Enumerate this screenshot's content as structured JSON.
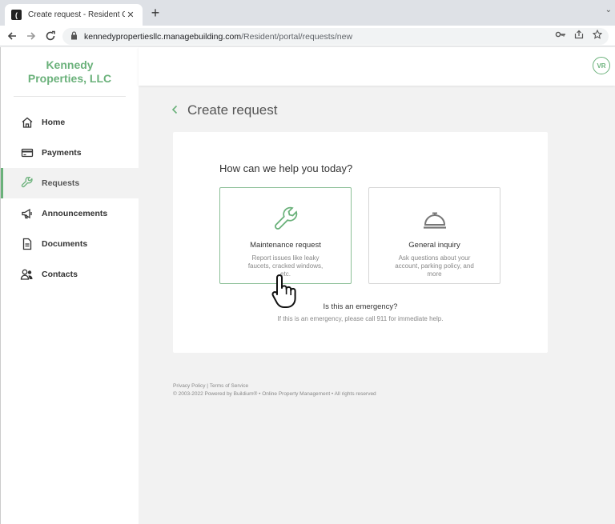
{
  "browser": {
    "tab_title": "Create request - Resident Center",
    "url_domain": "kennedypropertiesllc.managebuilding.com",
    "url_path": "/Resident/portal/requests/new"
  },
  "brand": {
    "line1": "Kennedy",
    "line2": "Properties, LLC",
    "color": "#6ab17a"
  },
  "sidebar": {
    "items": [
      {
        "label": "Home",
        "icon": "home-icon",
        "active": false
      },
      {
        "label": "Payments",
        "icon": "credit-card-icon",
        "active": false
      },
      {
        "label": "Requests",
        "icon": "wrench-icon",
        "active": true
      },
      {
        "label": "Announcements",
        "icon": "megaphone-icon",
        "active": false
      },
      {
        "label": "Documents",
        "icon": "document-icon",
        "active": false
      },
      {
        "label": "Contacts",
        "icon": "contacts-icon",
        "active": false
      }
    ]
  },
  "header": {
    "avatar_initials": "VR"
  },
  "page": {
    "title": "Create request",
    "question": "How can we help you today?",
    "options": [
      {
        "title": "Maintenance request",
        "description": "Report issues like leaky faucets, cracked windows, etc.",
        "icon": "wrench-icon"
      },
      {
        "title": "General inquiry",
        "description": "Ask questions about your account, parking policy, and more",
        "icon": "service-bell-icon"
      }
    ],
    "emergency_question": "Is this an emergency?",
    "emergency_help": "If this is an emergency, please call 911 for immediate help."
  },
  "footer": {
    "privacy": "Privacy Policy",
    "separator": "|",
    "terms": "Terms of Service",
    "copyright": "© 2003-2022 Powered by Buildium® • Online Property Management • All rights reserved"
  }
}
